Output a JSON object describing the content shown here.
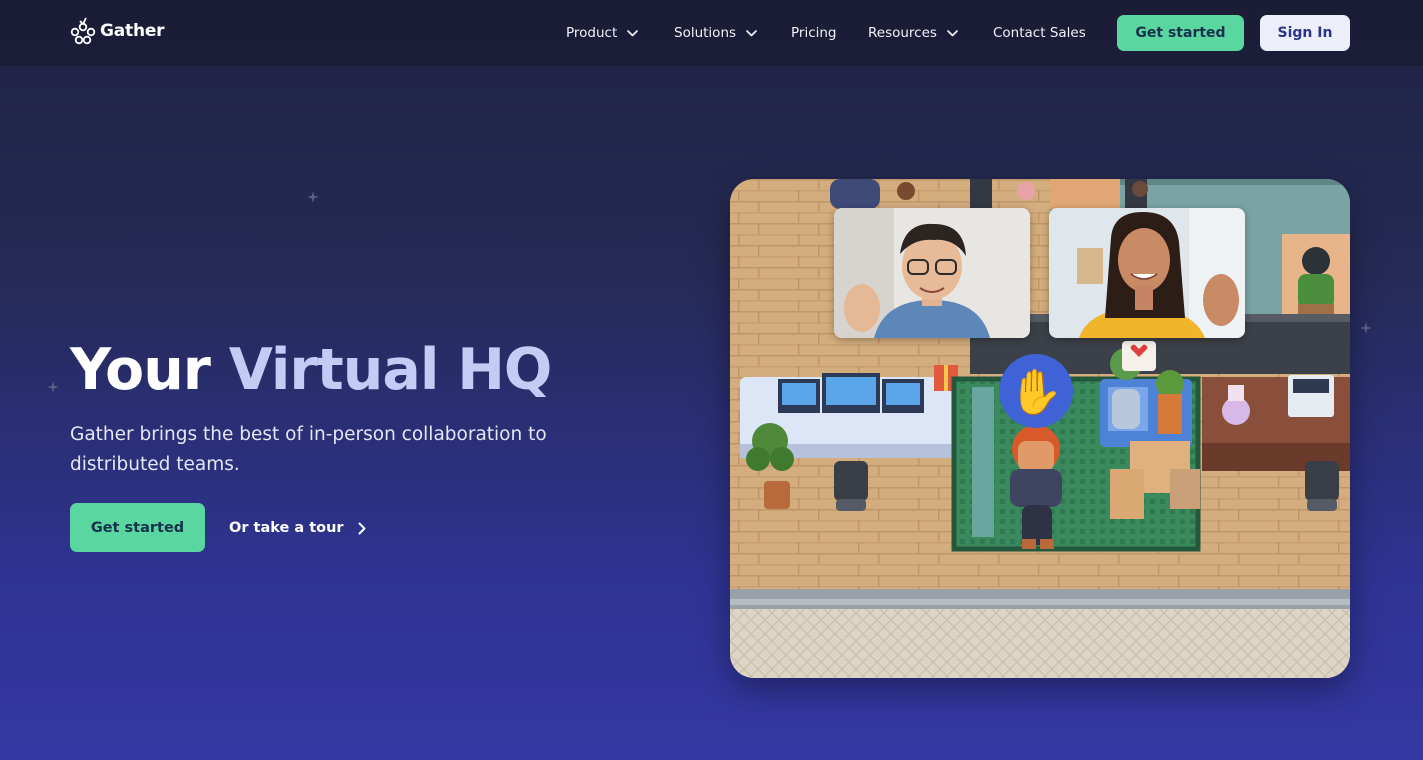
{
  "brand": {
    "name": "Gather"
  },
  "nav": {
    "items": [
      {
        "label": "Product",
        "has_dropdown": true
      },
      {
        "label": "Solutions",
        "has_dropdown": true
      },
      {
        "label": "Pricing",
        "has_dropdown": false
      },
      {
        "label": "Resources",
        "has_dropdown": true
      },
      {
        "label": "Contact Sales",
        "has_dropdown": false
      }
    ],
    "get_started_label": "Get started",
    "sign_in_label": "Sign In"
  },
  "hero": {
    "title_plain": "Your",
    "title_accent": "Virtual HQ",
    "subtitle": "Gather brings the best of in-person collaboration to distributed teams.",
    "cta_primary": "Get started",
    "cta_secondary": "Or take a tour"
  },
  "scene": {
    "wave_emoji": "✋"
  },
  "colors": {
    "accent_green": "#5ad6a1",
    "title_accent": "#c3ccf5",
    "background_top": "#1f2240",
    "background_bottom": "#3438a3"
  },
  "icons": [
    "gather-logo-icon",
    "chevron-down-icon",
    "chevron-right-icon",
    "sparkle-icon"
  ]
}
